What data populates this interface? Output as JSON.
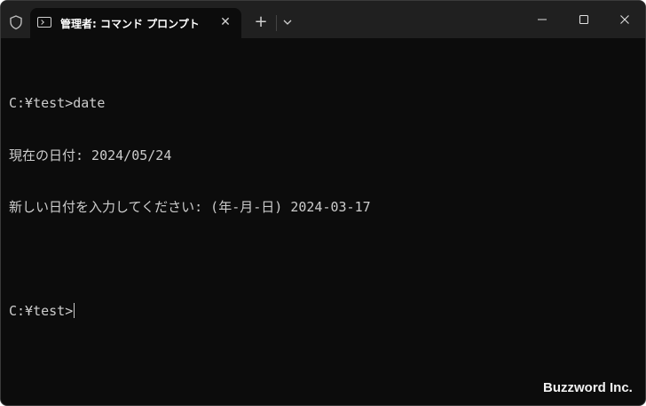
{
  "tab": {
    "title": "管理者: コマンド プロンプト",
    "close_glyph": "✕"
  },
  "titlebar": {
    "new_tab_glyph": "+",
    "icons": [
      "shield-icon",
      "command-prompt-icon",
      "close-icon",
      "plus-icon",
      "chevron-down-icon",
      "minimize-icon",
      "maximize-icon",
      "window-close-icon"
    ]
  },
  "terminal": {
    "lines": [
      "C:¥test>date",
      "現在の日付: 2024/05/24",
      "新しい日付を入力してください: (年-月-日) 2024-03-17",
      "",
      "C:¥test>"
    ]
  },
  "watermark": "Buzzword Inc.",
  "colors": {
    "titlebar": "#202020",
    "terminal_bg": "#0c0c0c",
    "terminal_fg": "#cccccc"
  }
}
